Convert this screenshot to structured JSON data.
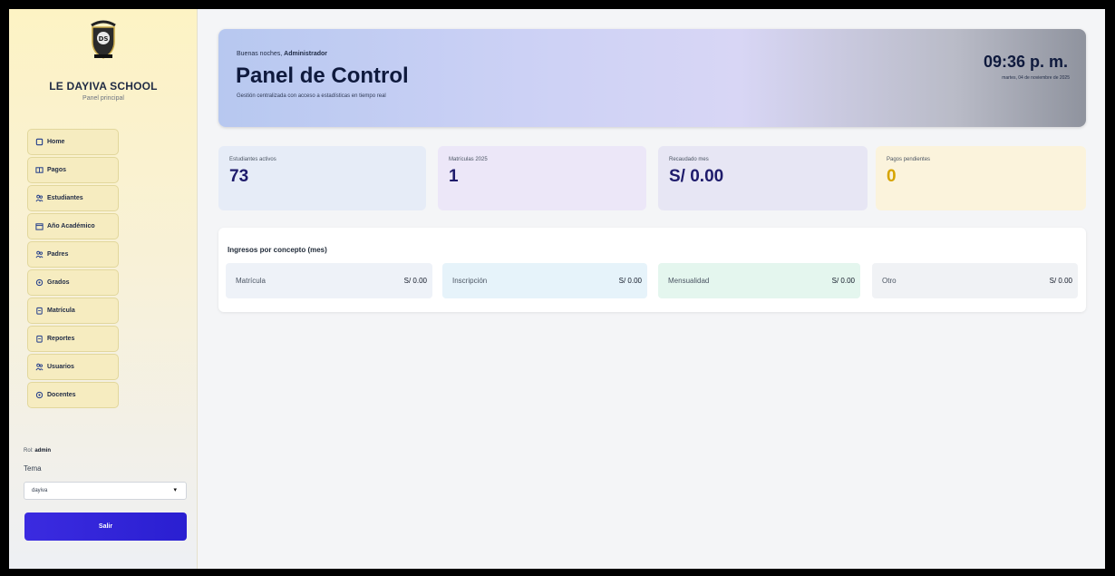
{
  "brand": {
    "name": "LE DAYIVA SCHOOL",
    "subtitle": "Panel principal"
  },
  "nav": [
    {
      "label": "Home",
      "icon": "home-icon"
    },
    {
      "label": "Pagos",
      "icon": "card-icon"
    },
    {
      "label": "Estudiantes",
      "icon": "users-icon"
    },
    {
      "label": "Año Académico",
      "icon": "calendar-icon"
    },
    {
      "label": "Padres",
      "icon": "users-icon"
    },
    {
      "label": "Grados",
      "icon": "gear-icon"
    },
    {
      "label": "Matrícula",
      "icon": "clipboard-icon"
    },
    {
      "label": "Reportes",
      "icon": "clipboard-icon"
    },
    {
      "label": "Usuarios",
      "icon": "users-icon"
    },
    {
      "label": "Docentes",
      "icon": "gear-icon"
    }
  ],
  "user": {
    "prefix": "Rol:",
    "name": "admin"
  },
  "theme": {
    "label": "Tema",
    "selected": "dayiva"
  },
  "logout_label": "Salir",
  "hero": {
    "greeting": "Buenas noches,",
    "greeting_user": "Administrador",
    "title": "Panel de Control",
    "subtitle": "Gestión centralizada con acceso a estadísticas en tiempo real",
    "time": "09:36 p. m.",
    "date": "martes, 04 de noviembre de 2025"
  },
  "stats": [
    {
      "label": "Estudiantes activos",
      "value": "73"
    },
    {
      "label": "Matrículas 2025",
      "value": "1"
    },
    {
      "label": "Recaudado mes",
      "value": "S/ 0.00"
    },
    {
      "label": "Pagos pendientes",
      "value": "0"
    }
  ],
  "income": {
    "title": "Ingresos por concepto (mes)",
    "items": [
      {
        "name": "Matrícula",
        "amount": "S/ 0.00"
      },
      {
        "name": "Inscripción",
        "amount": "S/ 0.00"
      },
      {
        "name": "Mensualidad",
        "amount": "S/ 0.00"
      },
      {
        "name": "Otro",
        "amount": "S/ 0.00"
      }
    ]
  }
}
